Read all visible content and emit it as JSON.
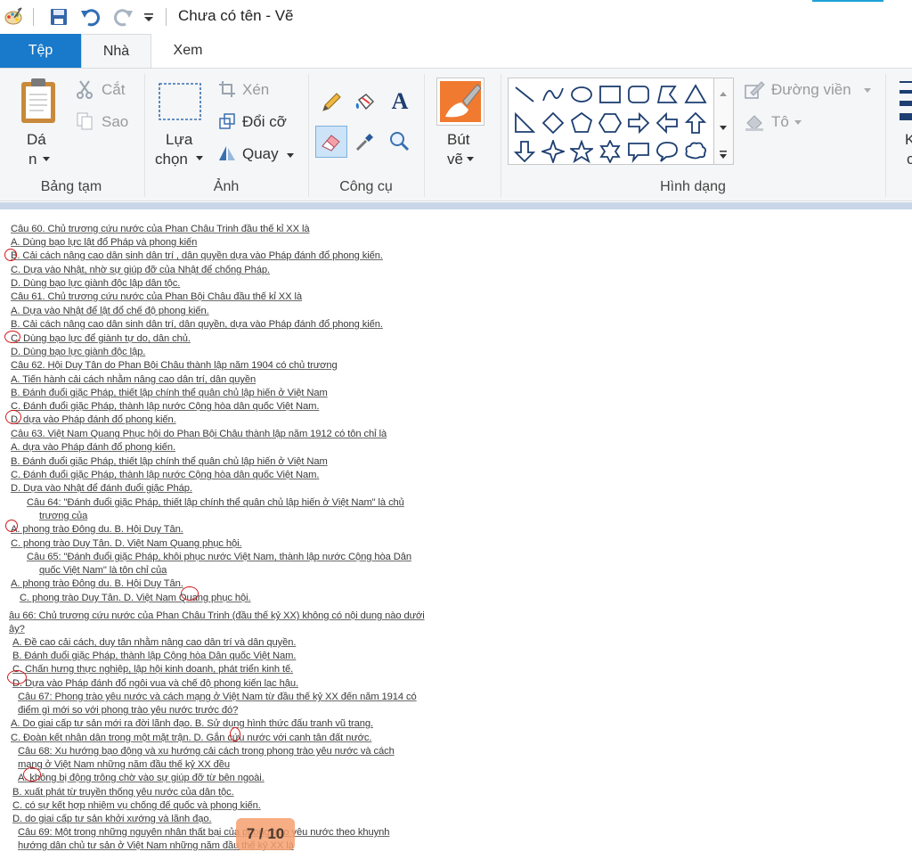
{
  "window": {
    "title": "Chưa có tên - Vẽ"
  },
  "tabs": [
    {
      "label": "Tệp"
    },
    {
      "label": "Nhà"
    },
    {
      "label": "Xem"
    }
  ],
  "ribbon": {
    "clipboard": {
      "paste_line1": "Dá",
      "paste_line2": "n",
      "cut": "Cắt",
      "copy": "Sao",
      "group": "Bảng tạm"
    },
    "image": {
      "select_line1": "Lựa",
      "select_line2": "chọn",
      "crop": "Xén",
      "resize": "Đổi cỡ",
      "rotate": "Quay",
      "group": "Ảnh"
    },
    "tools": {
      "group": "Công cụ",
      "text_icon": "A"
    },
    "brushes": {
      "line1": "Bút",
      "line2": "vẽ"
    },
    "shapes": {
      "outline": "Đường viền",
      "fill": "Tô",
      "group": "Hình dạng"
    },
    "colors": {
      "cut1": "K",
      "cut2": "c"
    }
  },
  "colors": {
    "accent": "#1979ca",
    "annotation": "#d01818",
    "badge": "#f6a06e"
  },
  "document": {
    "lines": [
      "Câu 60. Chủ trương cứu nước của Phan Châu Trinh đầu thế kỉ XX là",
      "A.  Dùng bạo lực lật đổ Pháp và phong kiến",
      "B.  Cải cách nâng cao dân sinh dân trí , dân quyền dựa vào Pháp đánh đổ phong kiến.",
      "C. Dựa vào Nhật, nhờ sự giúp đỡ của Nhật để chống Pháp.",
      "D. Dùng bạo lực giành độc lập dân tộc.",
      "Câu 61. Chủ trương cứu nước của Phan Bội Châu đầu thế kỉ XX là",
      "A. Dựa vào Nhật để lật đổ chế độ phong kiến.",
      "B. Cải cách nâng cao dân sinh dân trí, dân quyền, dựa vào Pháp đánh đổ phong kiến.",
      "C. Dùng bạo lực để giành tự do, dân chủ.",
      "D. Dùng bạo lực giành độc lập.",
      "Câu 62. Hội Duy Tân do Phan Bội Châu thành lập năm 1904 có chủ trương",
      "A.  Tiến hành cải cách nhằm nâng cao dân trí, dân quyền",
      "B.  Đánh đuổi giặc Pháp, thiết lập chính thể quân chủ lập hiến ở Việt Nam",
      "C. Đánh đuổi giặc Pháp, thành lập nước Cộng hòa dân quốc Việt Nam.",
      "D. dựa vào Pháp đánh đổ phong kiến.",
      "Câu 63. Việt Nam Quang Phục hội do Phan Bội Châu thành lập năm 1912 có tôn chỉ là",
      "A. dựa vào Pháp đánh đổ phong kiến.",
      "B. Đánh đuổi giặc Pháp, thiết lập chính thể quân chủ lập hiến ở Việt Nam",
      "C. Đánh đuổi giặc Pháp, thành lập nước Cộng hòa dân quốc Việt Nam.",
      "D. Dựa vào Nhật để đánh đuổi giặc Pháp.",
      "Câu 64: \"Đánh đuổi giặc Pháp, thiết lập chính thể quân chủ lập hiến ở Việt Nam\" là chủ",
      "trương của",
      "A.  phong trào Đông du.               B. Hội Duy Tân.",
      "C. phong trào Duy Tân.              D. Việt Nam Quang phục hội.",
      "Câu 65: \"Đánh đuổi giặc Pháp, khôi phục nước Việt Nam, thành lập nước Cộng hòa Dân",
      "quốc Việt Nam\" là tôn chỉ của",
      "A.      phong trào Đông du.                  B. Hội Duy Tân.",
      "C. phong trào Duy Tân.              D. Việt Nam Quang phục hội.",
      "âu 66: Chủ trương cứu nước của Phan Châu Trinh (đầu thế kỷ XX) không có nội dung nào dưới",
      "ây?",
      "A.   Đề cao cải cách, duy tân nhằm nâng cao dân trí và dân quyền.",
      "B.   Đánh đuổi giặc Pháp, thành lập Cộng hòa Dân quốc Việt Nam.",
      "C.   Chấn hưng thực nghiệp, lập hội kinh doanh, phát triển kinh tế.",
      "D.   Dựa vào Pháp đánh đổ ngôi vua và chế độ phong kiến lạc hậu.",
      "Câu 67: Phong trào yêu nước và cách mạng ở Việt Nam từ đầu thế kỷ XX đến năm 1914 có",
      "điểm gì mới so với phong trào yêu nước trước đó?",
      "A. Do giai cấp tư sản mới ra đời lãnh đạo.    B. Sử dụng hình thức đấu tranh vũ trang.",
      "C. Đoàn kết nhân dân trong một mặt trận.    D. Gắn cứu nước với canh tân đất nước.",
      "Câu 68: Xu hướng bạo động và xu hướng cải cách trong phong trào yêu nước và cách",
      "mạng ở Việt Nam những năm đầu thế kỷ XX đều",
      "A.      không bị động trông chờ vào sự giúp đỡ từ bên ngoài.",
      "B.  xuất phát từ truyền thống yêu nước của dân tộc.",
      "C.  có sự kết hợp nhiệm vụ chống đế quốc và phong kiến.",
      "D.  do giai cấp tư sản khởi xướng và lãnh đạo.",
      "Câu 69: Một trong những nguyên nhân thất bại của phong trào yêu nước theo khuynh",
      "hướng dân chủ tư sản ở Việt Nam những năm đầu thế kỷ XX là"
    ],
    "page_indicator": "7 / 10"
  }
}
